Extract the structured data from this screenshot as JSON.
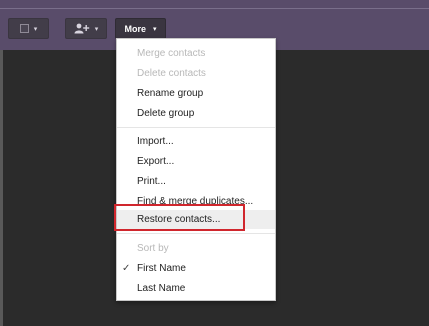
{
  "toolbar": {
    "select_caret": "▾",
    "add_caret": "▾",
    "more_label": "More",
    "more_caret": "▾"
  },
  "menu": {
    "items": [
      {
        "label": "Merge contacts",
        "enabled": false
      },
      {
        "label": "Delete contacts",
        "enabled": false
      },
      {
        "label": "Rename group",
        "enabled": true
      },
      {
        "label": "Delete group",
        "enabled": true
      },
      {
        "label": "Import...",
        "enabled": true
      },
      {
        "label": "Export...",
        "enabled": true
      },
      {
        "label": "Print...",
        "enabled": true
      },
      {
        "label": "Find & merge duplicates...",
        "enabled": true
      },
      {
        "label": "Restore contacts...",
        "enabled": true,
        "highlighted": true
      }
    ],
    "sort_heading": "Sort by",
    "sort_options": [
      {
        "label": "First Name",
        "selected": true
      },
      {
        "label": "Last Name",
        "selected": false
      }
    ],
    "check_glyph": "✓"
  },
  "colors": {
    "header": "#594c6a",
    "background": "#2b2b2b",
    "highlight_border": "#d0262d"
  }
}
